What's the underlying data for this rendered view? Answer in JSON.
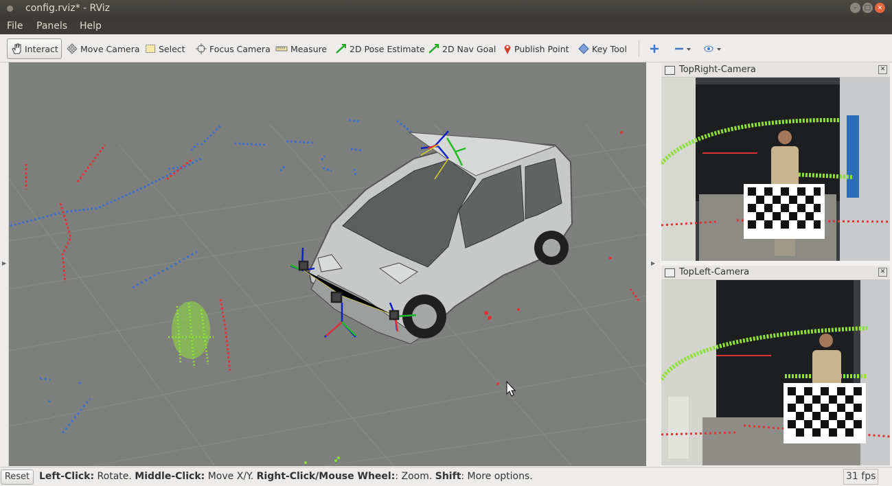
{
  "window": {
    "title": "config.rviz* - RViz"
  },
  "menu": [
    "File",
    "Panels",
    "Help"
  ],
  "toolbar": {
    "interact": "Interact",
    "move_camera": "Move Camera",
    "select": "Select",
    "focus_camera": "Focus Camera",
    "measure": "Measure",
    "pose_estimate": "2D Pose Estimate",
    "nav_goal": "2D Nav Goal",
    "publish_point": "Publish Point",
    "key_tool": "Key Tool"
  },
  "panels": {
    "top_right": "TopRight-Camera",
    "top_left": "TopLeft-Camera"
  },
  "status": {
    "reset": "Reset",
    "hint_1b": "Left-Click:",
    "hint_1": " Rotate. ",
    "hint_2b": "Middle-Click:",
    "hint_2": " Move X/Y. ",
    "hint_3b": "Right-Click/Mouse Wheel:",
    "hint_3": ": Zoom. ",
    "hint_4b": "Shift",
    "hint_4": ": More options.",
    "fps": "31 fps"
  },
  "colors": {
    "accent": "#e4663a",
    "grid_bg": "#7d7f7c",
    "laser_blue": "#3b6fc9",
    "laser_red": "#e03434",
    "laser_green": "#8fe03a"
  }
}
